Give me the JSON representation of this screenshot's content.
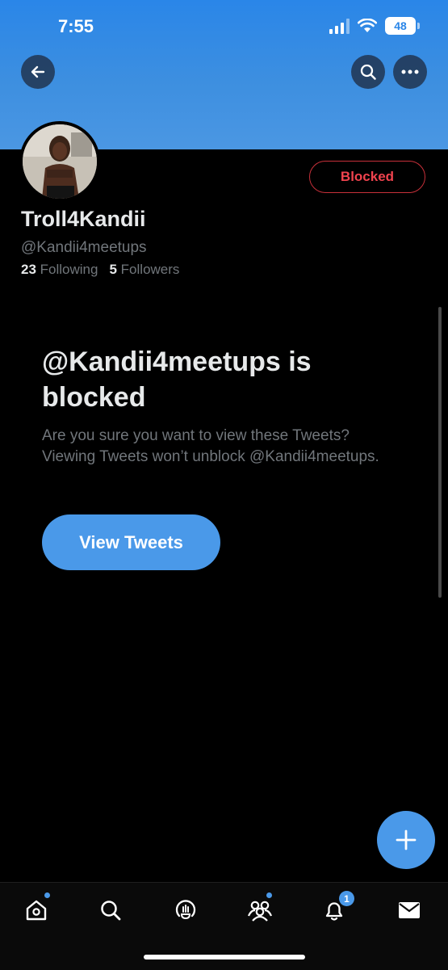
{
  "status_bar": {
    "time": "7:55",
    "battery": "48"
  },
  "header": {
    "back_icon": "arrow-left-icon",
    "search_icon": "search-icon",
    "more_icon": "more-horizontal-icon"
  },
  "profile": {
    "display_name": "Troll4Kandii",
    "handle": "@Kandii4meetups",
    "following_count": "23",
    "following_label": "Following",
    "followers_count": "5",
    "followers_label": "Followers",
    "blocked_label": "Blocked"
  },
  "blocked_notice": {
    "title": "@Kandii4meetups is blocked",
    "description": "Are you sure you want to view these Tweets? Viewing Tweets won’t unblock @Kandii4meetups.",
    "button_label": "View Tweets"
  },
  "tabbar": {
    "items": [
      "home-icon",
      "search-icon",
      "spaces-icon",
      "communities-icon",
      "notifications-icon",
      "messages-icon"
    ],
    "notification_count": "1"
  },
  "colors": {
    "accent": "#4a99e9",
    "blocked": "#f0434e",
    "banner": "#3d8fe0"
  }
}
